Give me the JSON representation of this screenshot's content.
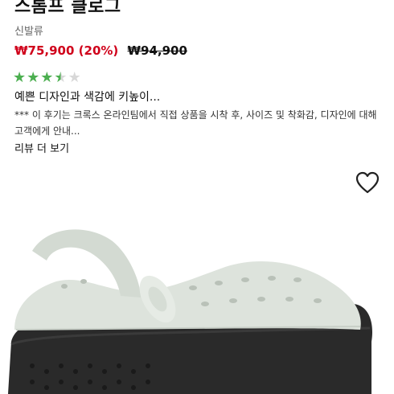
{
  "product": {
    "title": "스톰프 클로그",
    "category": "신발류",
    "sale_price": "₩75,900 (20%)",
    "original_price": "₩94,900"
  },
  "rating": {
    "value": 3.5,
    "max": 5,
    "color_filled": "#4caf50",
    "color_empty": "#d8d8d8"
  },
  "review": {
    "title": "예쁜 디자인과 색감에 키높이...",
    "body": "*** 이 후기는 크록스 온라인팀에서 직접 상품을 시착 후, 사이즈 및 착화감, 디자인에 대해 고객에게 안내...",
    "more_link": "리뷰 더 보기"
  },
  "icons": {
    "wishlist": "heart-icon"
  },
  "colors": {
    "sale_price": "#d0021b",
    "shoe_upper": "#dde3dc",
    "shoe_sole": "#2a2a2a"
  }
}
